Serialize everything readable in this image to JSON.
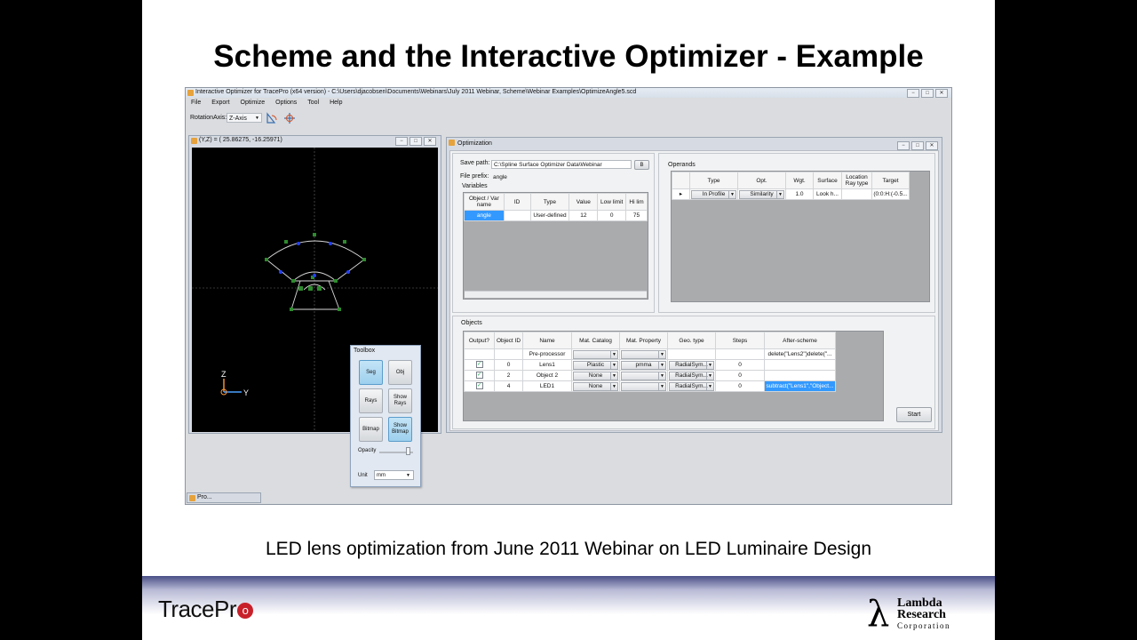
{
  "slide": {
    "title": "Scheme and the Interactive Optimizer - Example",
    "caption": "LED lens optimization from June 2011 Webinar on LED Luminaire Design",
    "logo_left": "TracePro",
    "logo_right": [
      "Lambda",
      "Research",
      "Corporation"
    ]
  },
  "app": {
    "title": "Interactive Optimizer for TracePro (x64 version) - C:\\Users\\djacobsen\\Documents\\Webinars\\July 2011 Webinar, Scheme\\Webinar Examples\\OptimizeAngle5.scd",
    "menu": [
      "File",
      "Export",
      "Optimize",
      "Options",
      "Tool",
      "Help"
    ],
    "toolbar": {
      "rotation_label": "RotationAxis:",
      "rotation_value": "Z-Axis"
    },
    "window_buttons": [
      "−",
      "□",
      "✕"
    ]
  },
  "viewer": {
    "title": "(Y,Z) = ( 25.86275, -16.25971)",
    "axis_z": "Z",
    "axis_y": "Y"
  },
  "toolbox": {
    "title": "Toolbox",
    "buttons": [
      "Seg",
      "Obj",
      "Rays",
      "Show Rays",
      "Bitmap",
      "Show Bitmap"
    ],
    "opacity_label": "Opacity",
    "opacity": 0.9,
    "unit_label": "Unit",
    "unit_value": "mm"
  },
  "minimized_tab": {
    "title": "Pro..."
  },
  "optimization": {
    "title": "Optimization",
    "save_path_label": "Save path:",
    "save_path": "C:\\Spline Surface Optimizer Data\\Webinar",
    "browse": "B",
    "file_prefix_label": "File prefix:",
    "file_prefix": "angle",
    "variables_label": "Variables",
    "variables": {
      "headers": [
        "Object / Var name",
        "ID",
        "Type",
        "Value",
        "Low limit",
        "Hi lim"
      ],
      "rows": [
        [
          "angle",
          "",
          "User-defined",
          "12",
          "0",
          "75"
        ]
      ]
    },
    "operands_label": "Operands",
    "operands": {
      "headers": [
        "",
        "Type",
        "Opt.",
        "Wgt.",
        "Surface",
        "Location Ray type",
        "Target"
      ],
      "rows": [
        [
          "▸",
          "In Profile",
          "Similarity",
          "1.0",
          "Look h...",
          "",
          "(0:0:H:(-0.5..."
        ]
      ]
    },
    "objects_label": "Objects",
    "objects": {
      "headers": [
        "Output?",
        "Object ID",
        "Name",
        "Mat. Catalog",
        "Mat. Property",
        "Geo. type",
        "Steps",
        "After-scheme"
      ],
      "rows": [
        {
          "output": false,
          "id": "",
          "name": "Pre-processor",
          "catalog": "",
          "property": "",
          "geo": "",
          "steps": "",
          "after": "delete(\"Lens2\")delete(\"..."
        },
        {
          "output": true,
          "id": "0",
          "name": "Lens1",
          "catalog": "Plastic",
          "property": "pmma",
          "geo": "RadialSym...",
          "steps": "0",
          "after": ""
        },
        {
          "output": true,
          "id": "2",
          "name": "Object 2",
          "catalog": "None",
          "property": "",
          "geo": "RadialSym...",
          "steps": "0",
          "after": ""
        },
        {
          "output": true,
          "id": "4",
          "name": "LED1",
          "catalog": "None",
          "property": "",
          "geo": "RadialSym...",
          "steps": "0",
          "after": "subtract(\"Lens1\",\"Object..."
        }
      ]
    },
    "start": "Start"
  }
}
